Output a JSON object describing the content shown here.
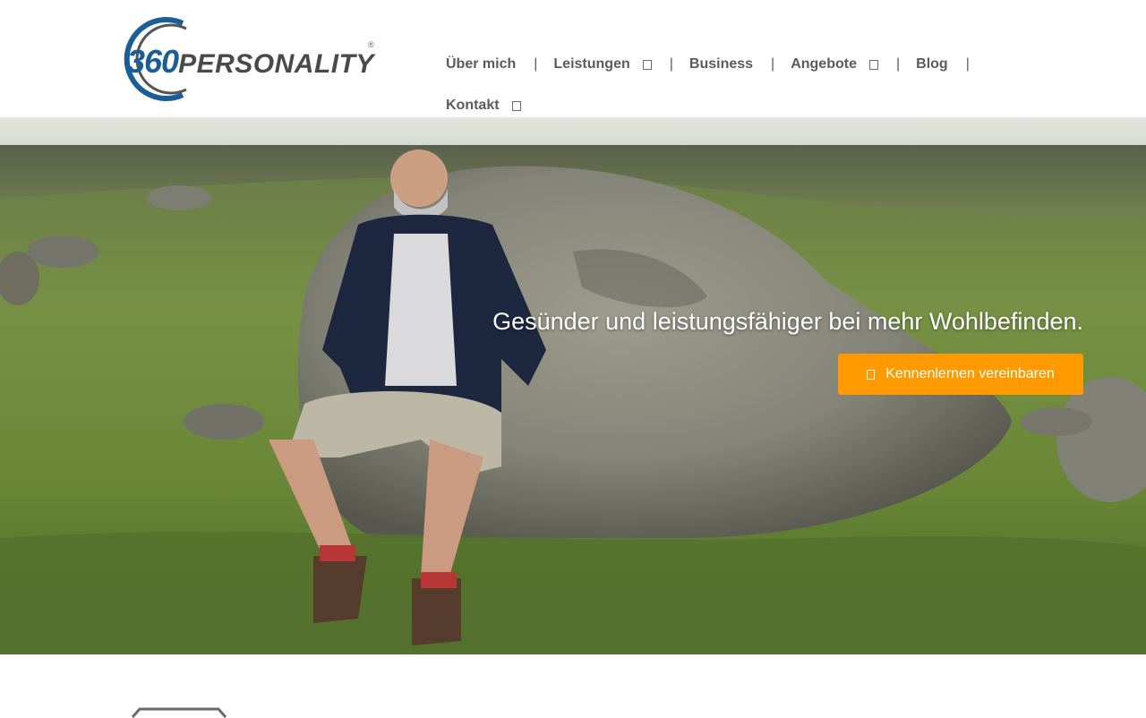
{
  "logo": {
    "number": "360",
    "word": "PERSONALITY",
    "registered": "®",
    "brand_blue": "#1a5d97",
    "brand_gray": "#4a4a4a"
  },
  "nav": {
    "items": [
      {
        "label": "Über mich",
        "has_submenu": false
      },
      {
        "label": "Leistungen",
        "has_submenu": true
      },
      {
        "label": "Business",
        "has_submenu": false
      },
      {
        "label": "Angebote",
        "has_submenu": true
      },
      {
        "label": "Blog",
        "has_submenu": false
      },
      {
        "label": "Kontakt",
        "has_submenu": true
      }
    ],
    "separator": "|"
  },
  "hero": {
    "tagline": "Gesünder und leistungsfähiger bei mehr Wohlbefinden.",
    "cta_label": "Kennenlernen vereinbaren",
    "cta_icon": "calendar-icon",
    "cta_color": "#ff9b00"
  }
}
